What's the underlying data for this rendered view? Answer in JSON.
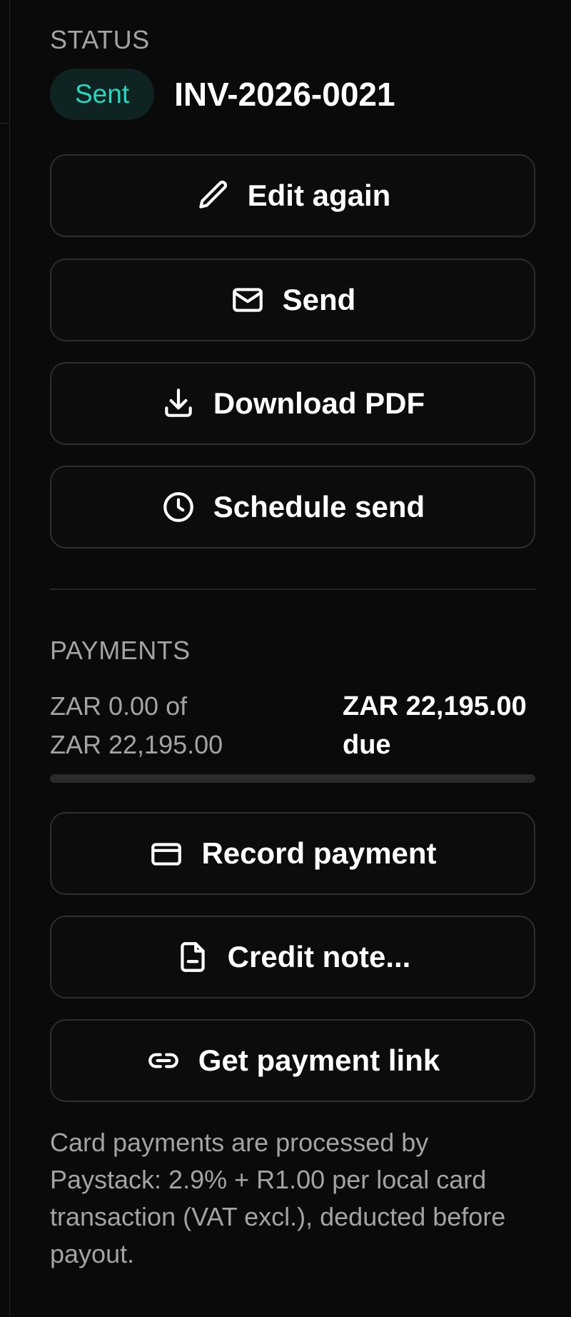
{
  "status": {
    "label": "STATUS",
    "badge": "Sent",
    "invoice_number": "INV-2026-0021"
  },
  "actions": {
    "edit_again": "Edit again",
    "send": "Send",
    "download_pdf": "Download PDF",
    "schedule_send": "Schedule send"
  },
  "payments": {
    "label": "PAYMENTS",
    "paid_line1": "ZAR 0.00 of",
    "paid_line2": "ZAR 22,195.00",
    "due_line1": "ZAR 22,195.00",
    "due_line2": "due",
    "progress_fraction": 0.0,
    "record_payment": "Record payment",
    "credit_note": "Credit note...",
    "get_payment_link": "Get payment link",
    "fee_note": "Card payments are processed by Paystack: 2.9% + R1.00 per local card transaction (VAT excl.), deducted before payout."
  },
  "colors": {
    "accent": "#2dd4bf",
    "background": "#0a0a0a",
    "badge_background": "#0f2422"
  },
  "icons": {
    "edit_again": "pencil-icon",
    "send": "envelope-icon",
    "download_pdf": "download-icon",
    "schedule_send": "clock-icon",
    "record_payment": "credit-card-icon",
    "credit_note": "document-icon",
    "get_payment_link": "link-icon"
  }
}
